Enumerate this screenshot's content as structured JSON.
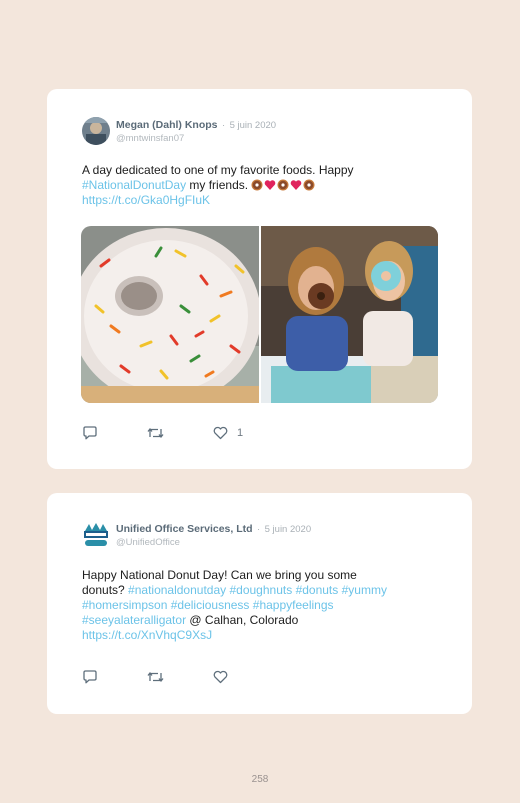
{
  "tweets": [
    {
      "author": "Megan (Dahl) Knops",
      "separator": "·",
      "date": "5 juin 2020",
      "handle": "@mntwinsfan07",
      "text_1": "A day dedicated to one of my favorite foods. Happy",
      "hashtag": "#NationalDonutDay",
      "text_2": " my friends. ",
      "emojis": [
        "donut-emoji",
        "heart-emoji",
        "donut-emoji",
        "heart-emoji",
        "donut-emoji"
      ],
      "link": "https://t.co/Gka0HgFIuK",
      "likes": "1",
      "photos": [
        "frosted sprinkle donut photo",
        "two women with donuts photo"
      ]
    },
    {
      "author": "Unified Office Services, Ltd",
      "separator": "·",
      "date": "5 juin 2020",
      "handle": "@UnifiedOffice",
      "line1": "Happy National Donut Day! Can we bring you some",
      "line2_text": "donuts? ",
      "hashtags_line2": [
        "#nationaldonutday",
        "#doughnuts",
        "#donuts",
        "#yummy"
      ],
      "hashtags_line3": [
        "#homersimpson",
        "#deliciousness",
        "#happyfeelings"
      ],
      "hashtag_line4": "#seeyalateralligator",
      "location": " @ Calhan, Colorado",
      "link": "https://t.co/XnVhqC9XsJ"
    }
  ],
  "page_number": "258"
}
